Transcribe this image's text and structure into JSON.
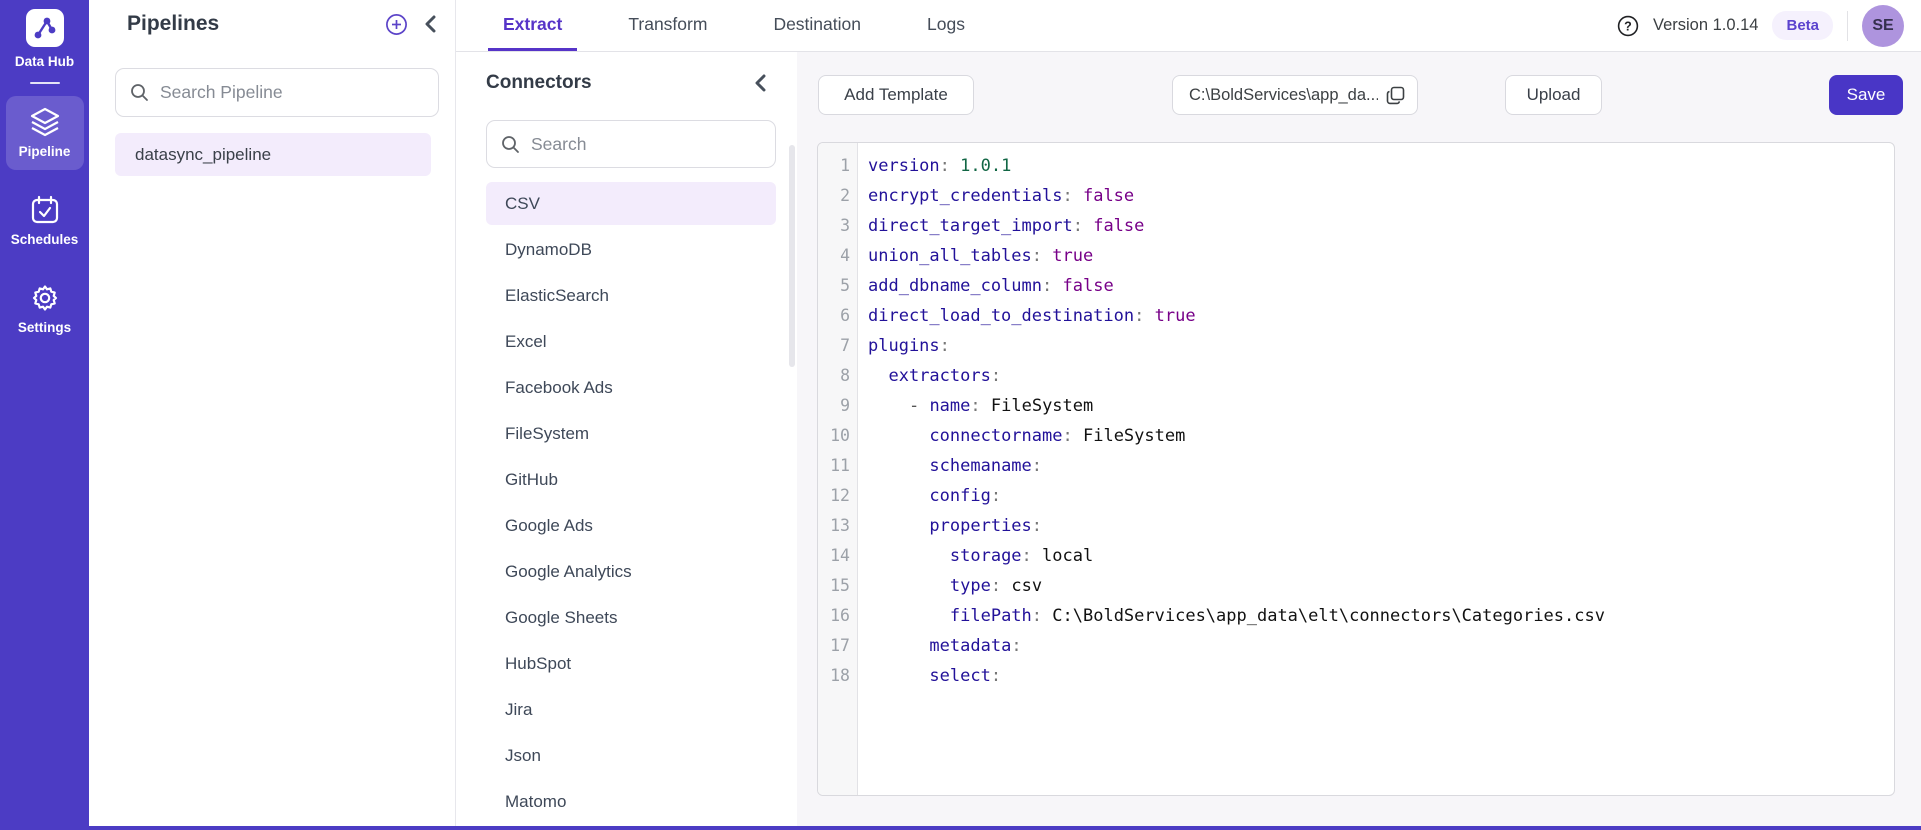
{
  "app": {
    "name": "Data Hub",
    "version_label": "Version 1.0.14",
    "beta_label": "Beta",
    "avatar_initials": "SE"
  },
  "colors": {
    "sidebar": "#4C3CC4",
    "accent": "#5634C8",
    "selection_bg": "#F3ECFC",
    "save_bg": "#4936C6",
    "avatar_bg": "#AE94DE"
  },
  "sidebar": {
    "items": [
      {
        "label": "Pipeline",
        "icon": "layers-icon",
        "active": true
      },
      {
        "label": "Schedules",
        "icon": "calendar-icon",
        "active": false
      },
      {
        "label": "Settings",
        "icon": "gear-icon",
        "active": false
      }
    ]
  },
  "pipelines_panel": {
    "title": "Pipelines",
    "search_placeholder": "Search Pipeline",
    "items": [
      {
        "name": "datasync_pipeline",
        "selected": true
      }
    ]
  },
  "tabs": [
    {
      "label": "Extract",
      "active": true
    },
    {
      "label": "Transform",
      "active": false
    },
    {
      "label": "Destination",
      "active": false
    },
    {
      "label": "Logs",
      "active": false
    }
  ],
  "connectors_panel": {
    "title": "Connectors",
    "search_placeholder": "Search",
    "selected": "CSV",
    "items": [
      "CSV",
      "DynamoDB",
      "ElasticSearch",
      "Excel",
      "Facebook Ads",
      "FileSystem",
      "GitHub",
      "Google Ads",
      "Google Analytics",
      "Google Sheets",
      "HubSpot",
      "Jira",
      "Json",
      "Matomo"
    ]
  },
  "toolbar": {
    "add_template_label": "Add Template",
    "path_value": "C:\\BoldServices\\app_da...",
    "upload_label": "Upload",
    "save_label": "Save"
  },
  "editor": {
    "lines": [
      "version: 1.0.1",
      "encrypt_credentials: false",
      "direct_target_import: false",
      "union_all_tables: true",
      "add_dbname_column: false",
      "direct_load_to_destination: true",
      "plugins:",
      "  extractors:",
      "    - name: FileSystem",
      "      connectorname: FileSystem",
      "      schemaname:",
      "      config:",
      "      properties:",
      "        storage: local",
      "        type: csv",
      "        filePath: C:\\BoldServices\\app_data\\elt\\connectors\\Categories.csv",
      "      metadata:",
      "      select:"
    ]
  }
}
